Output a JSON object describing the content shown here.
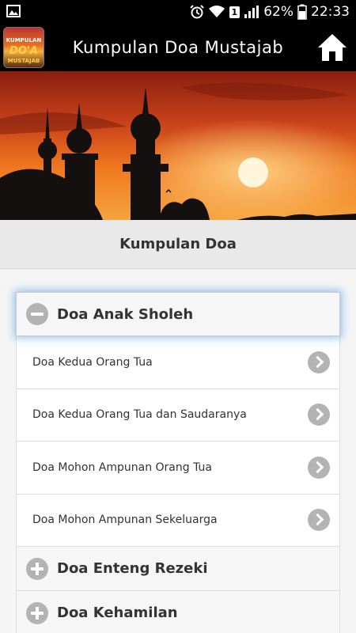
{
  "status_bar": {
    "sim": "1",
    "battery_percent": "62%",
    "time": "22:33"
  },
  "app_bar": {
    "logo_words": [
      "KUMPULAN",
      "DO'A",
      "MUSTAJAB"
    ],
    "title": "Kumpulan Doa Mustajab",
    "home_icon": "home-icon"
  },
  "section": {
    "title": "Kumpulan Doa"
  },
  "accordion": {
    "open_group": {
      "title": "Doa Anak Sholeh",
      "items": [
        "Doa Kedua Orang Tua",
        "Doa Kedua Orang Tua dan Saudaranya",
        "Doa Mohon Ampunan Orang Tua",
        "Doa Mohon Ampunan Sekeluarga"
      ]
    },
    "closed_groups": [
      "Doa Enteng Rezeki",
      "Doa Kehamilan"
    ]
  },
  "colors": {
    "accent_glow": "#388ce6",
    "icon_grey": "#b3b3b3"
  }
}
